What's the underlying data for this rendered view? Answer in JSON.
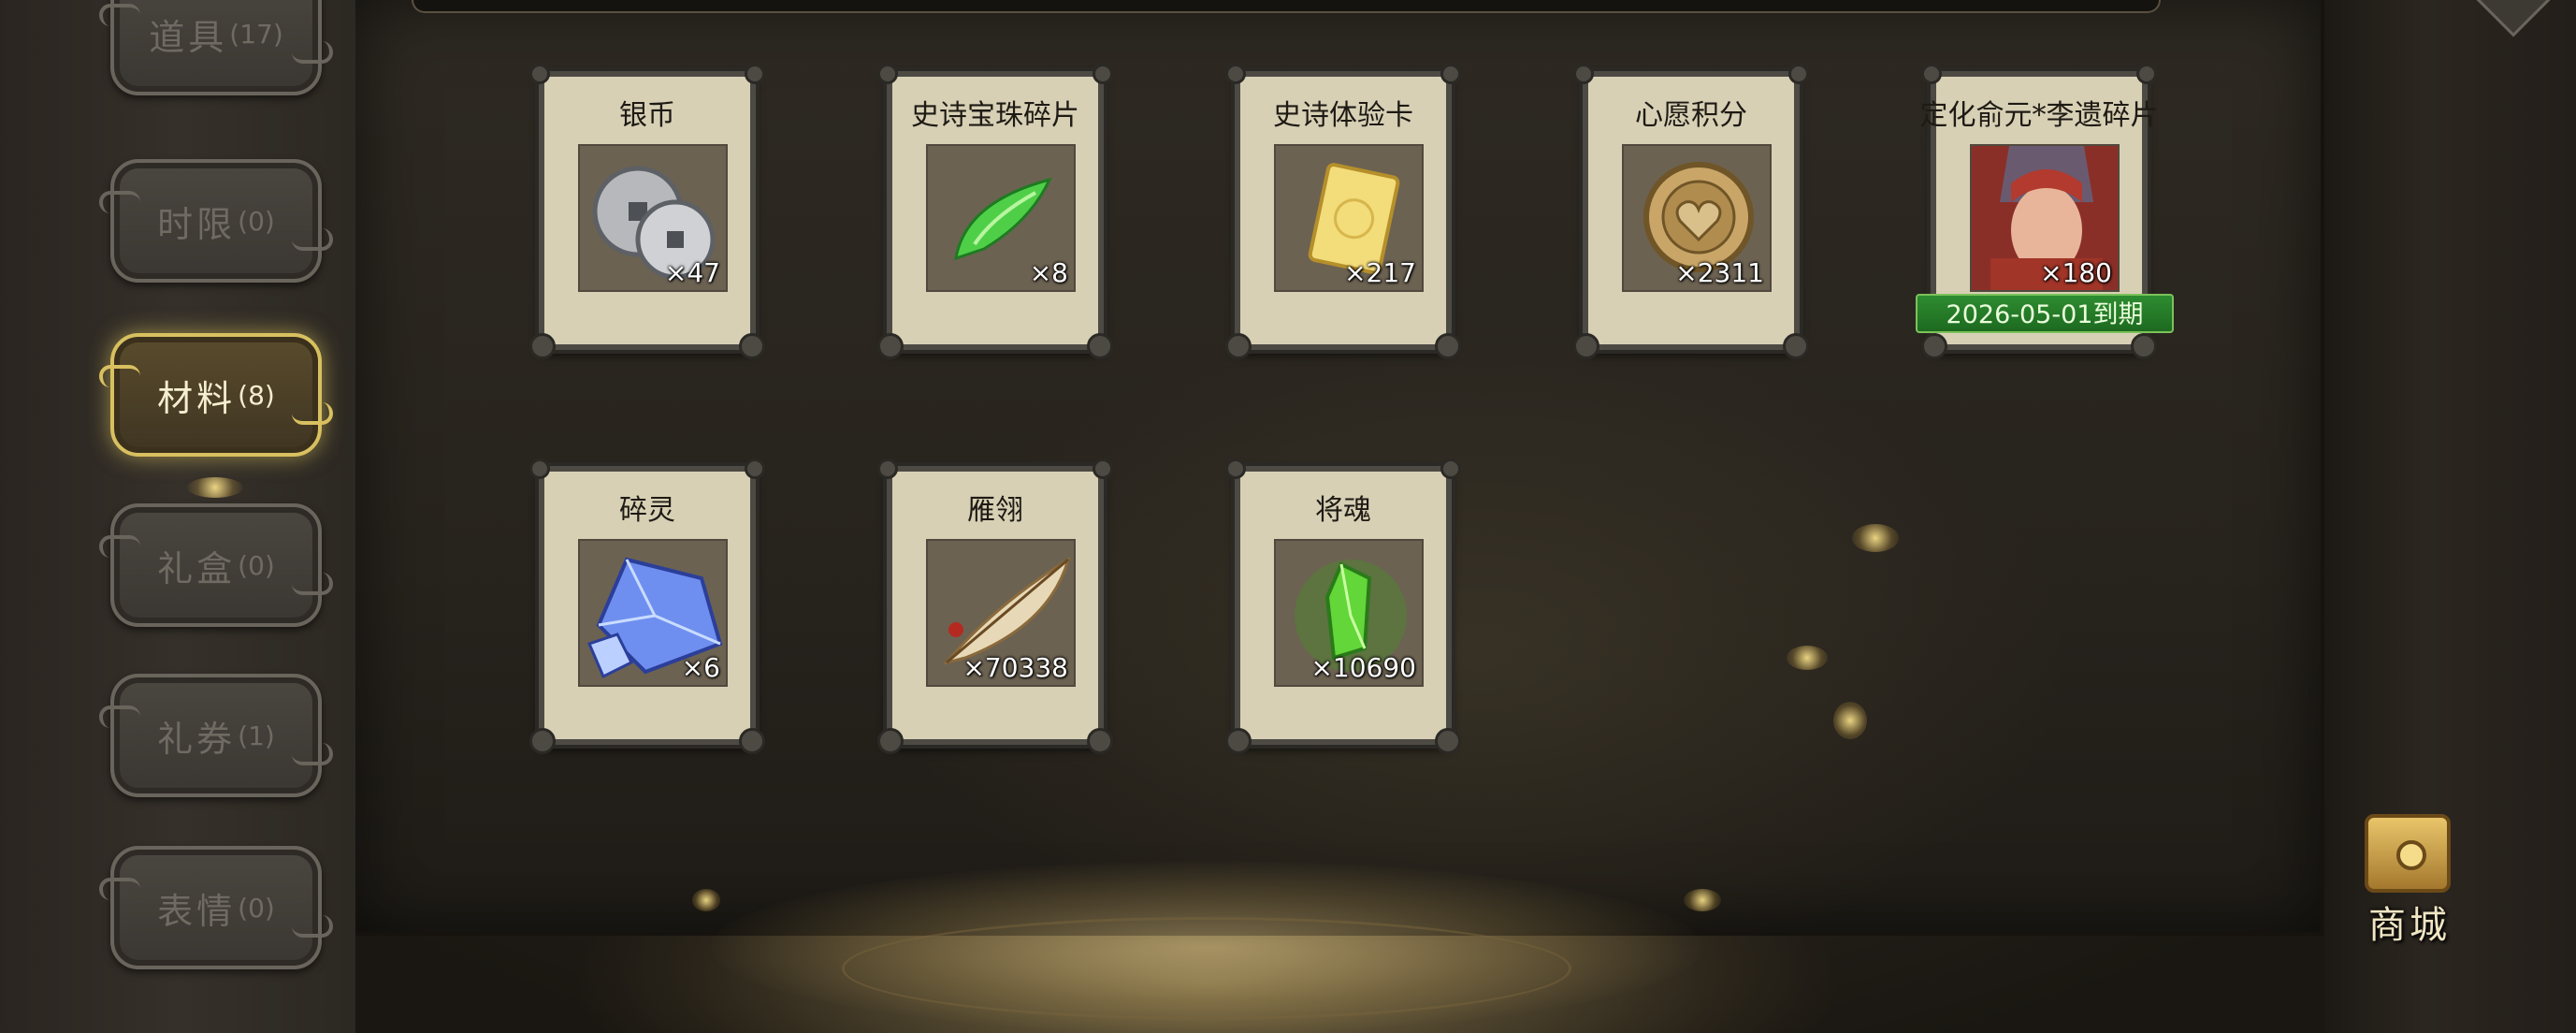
{
  "sidebar": {
    "tabs": [
      {
        "label": "道具",
        "count": "(17)",
        "active": false
      },
      {
        "label": "时限",
        "count": "(0)",
        "active": false
      },
      {
        "label": "材料",
        "count": "(8)",
        "active": true
      },
      {
        "label": "礼盒",
        "count": "(0)",
        "active": false
      },
      {
        "label": "礼券",
        "count": "(1)",
        "active": false
      },
      {
        "label": "表情",
        "count": "(0)",
        "active": false
      }
    ]
  },
  "items": [
    {
      "name": "银币",
      "count": "×47",
      "icon": "silver-coin-icon"
    },
    {
      "name": "史诗宝珠碎片",
      "count": "×8",
      "icon": "green-jade-shard-icon"
    },
    {
      "name": "史诗体验卡",
      "count": "×217",
      "icon": "gold-card-icon"
    },
    {
      "name": "心愿积分",
      "count": "×2311",
      "icon": "heart-coin-icon"
    },
    {
      "name": "定化俞元*李遗碎片",
      "count": "×180",
      "icon": "hero-portrait-icon",
      "expire": "2026-05-01到期"
    },
    {
      "name": "碎灵",
      "count": "×6",
      "icon": "blue-crystal-icon"
    },
    {
      "name": "雁翎",
      "count": "×70338",
      "icon": "feather-icon"
    },
    {
      "name": "将魂",
      "count": "×10690",
      "icon": "green-soul-crystal-icon"
    }
  ],
  "shop": {
    "label": "商城"
  },
  "colors": {
    "active_tab_border": "#d8c060",
    "expire_bg": "#2e8c30",
    "card_bg": "#d7d0b5"
  }
}
